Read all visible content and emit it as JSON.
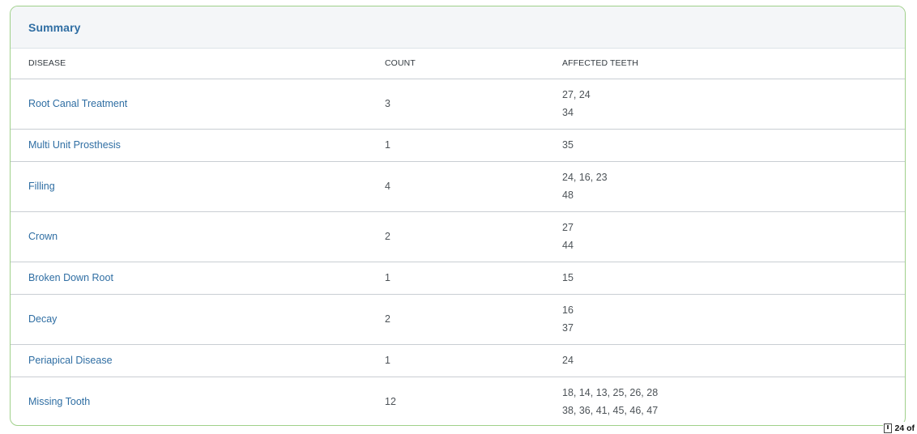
{
  "summary": {
    "title": "Summary",
    "headers": {
      "disease": "DISEASE",
      "count": "COUNT",
      "teeth": "AFFECTED TEETH"
    },
    "rows": [
      {
        "disease": "Root Canal Treatment",
        "count": "3",
        "teeth": [
          "27, 24",
          "34"
        ]
      },
      {
        "disease": "Multi Unit Prosthesis",
        "count": "1",
        "teeth": [
          "35"
        ]
      },
      {
        "disease": "Filling",
        "count": "4",
        "teeth": [
          "24, 16, 23",
          "48"
        ]
      },
      {
        "disease": "Crown",
        "count": "2",
        "teeth": [
          "27",
          "44"
        ]
      },
      {
        "disease": "Broken Down Root",
        "count": "1",
        "teeth": [
          "15"
        ]
      },
      {
        "disease": "Decay",
        "count": "2",
        "teeth": [
          "16",
          "37"
        ]
      },
      {
        "disease": "Periapical Disease",
        "count": "1",
        "teeth": [
          "24"
        ]
      },
      {
        "disease": "Missing Tooth",
        "count": "12",
        "teeth": [
          "18, 14, 13, 25, 26, 28",
          "38, 36, 41, 45, 46, 47"
        ]
      }
    ]
  },
  "page_indicator": {
    "text": "24 of",
    "icon": "page-icon"
  },
  "colors": {
    "accent": "#2f6ea3",
    "card_border": "#9fd08a",
    "header_bg": "#f4f6f8"
  }
}
